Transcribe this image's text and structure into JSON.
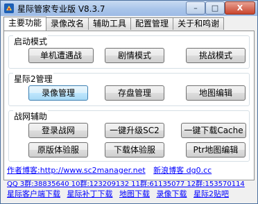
{
  "window": {
    "title": "星际管家专业版 V8.3.7",
    "buttons": {
      "minimize": "–",
      "maximize": "□",
      "close": "X"
    }
  },
  "tabs": [
    {
      "label": "主要功能",
      "active": true
    },
    {
      "label": "录像改名",
      "active": false
    },
    {
      "label": "辅助工具",
      "active": false
    },
    {
      "label": "配置管理",
      "active": false
    },
    {
      "label": "关于和鸣谢",
      "active": false
    }
  ],
  "groups": {
    "startup": {
      "title": "启动模式",
      "buttons": [
        "单机遭遇战",
        "剧情模式",
        "挑战模式"
      ]
    },
    "sc2": {
      "title": "星际2管理",
      "buttons": [
        "录像管理",
        "存盘管理",
        "地图编辑"
      ]
    },
    "battlenet": {
      "title": "战网辅助",
      "buttons": [
        "登录战网",
        "一键升级SC2",
        "一键下载Cache",
        "原版体验服",
        "下载体验服",
        "Ptr地图编辑"
      ]
    }
  },
  "links": {
    "blog_label": "作者博客:",
    "blog_url": "http://www.sc2manager.net",
    "extra": "新浪博客 dg0.cc",
    "qq": "QQ 3群:38835640  10群:123209132  11群:61135077  12群:153570114",
    "bottom": [
      "星际客户端下载",
      "星际补丁下载",
      "地图下载",
      "录像下载",
      "星际2贴吧"
    ]
  }
}
